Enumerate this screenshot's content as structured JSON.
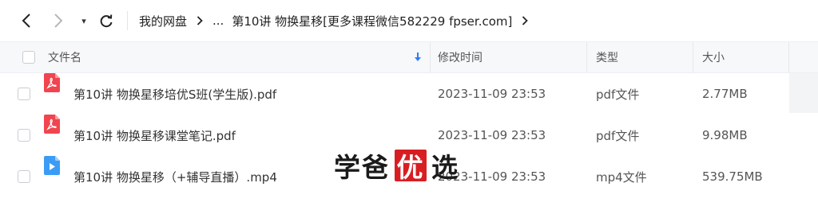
{
  "toolbar": {
    "dropdown_glyph": "▾",
    "breadcrumb": {
      "root": "我的网盘",
      "ellipsis": "...",
      "current": "第10讲 物换星移[更多课程微信582229 fpser.com]"
    }
  },
  "table": {
    "columns": {
      "name": "文件名",
      "modified": "修改时间",
      "type": "类型",
      "size": "大小"
    },
    "rows": [
      {
        "icon": "pdf-icon",
        "name": "第10讲 物换星移培优S班(学生版).pdf",
        "modified": "2023-11-09 23:53",
        "type": "pdf文件",
        "size": "2.77MB"
      },
      {
        "icon": "pdf-icon",
        "name": "第10讲 物换星移课堂笔记.pdf",
        "modified": "2023-11-09 23:53",
        "type": "pdf文件",
        "size": "9.98MB"
      },
      {
        "icon": "video-icon",
        "name": "第10讲 物换星移（+辅导直播）.mp4",
        "modified": "2023-11-09 23:53",
        "type": "mp4文件",
        "size": "539.75MB"
      }
    ]
  },
  "watermark": {
    "part1": "学爸",
    "part2": "优",
    "part3": "选"
  },
  "colors": {
    "pdf": "#f0454f",
    "video": "#3b9cf5",
    "sort": "#2f7df6",
    "watermark_red": "#d81e22"
  }
}
